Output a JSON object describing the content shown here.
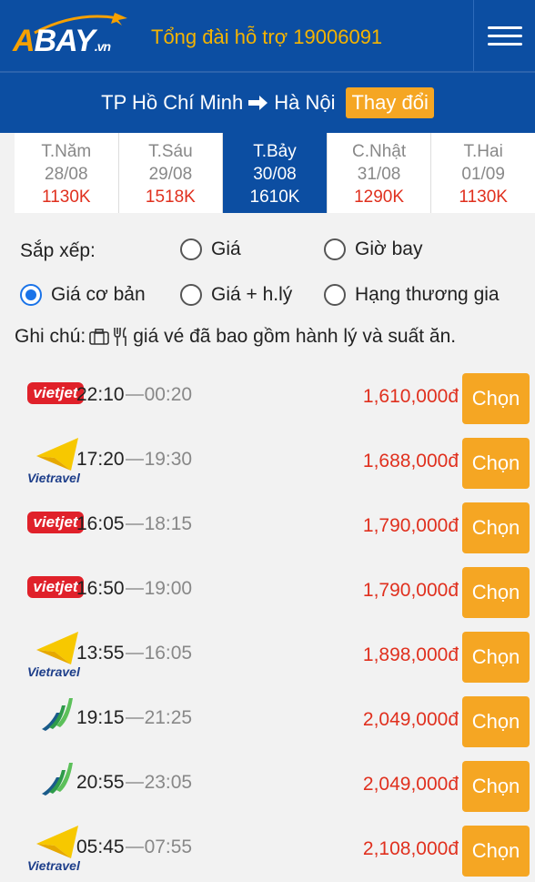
{
  "header": {
    "logo_text": "BAY",
    "logo_suffix": ".vn",
    "logo_a": "A",
    "hotline": "Tổng đài hỗ trợ 19006091"
  },
  "route": {
    "from": "TP Hồ Chí Minh",
    "to": "Hà Nội",
    "change_label": "Thay đổi"
  },
  "dates": [
    {
      "day": "T.Năm",
      "date": "28/08",
      "price": "1130K",
      "active": false
    },
    {
      "day": "T.Sáu",
      "date": "29/08",
      "price": "1518K",
      "active": false
    },
    {
      "day": "T.Bảy",
      "date": "30/08",
      "price": "1610K",
      "active": true
    },
    {
      "day": "C.Nhật",
      "date": "31/08",
      "price": "1290K",
      "active": false
    },
    {
      "day": "T.Hai",
      "date": "01/09",
      "price": "1130K",
      "active": false
    }
  ],
  "sort": {
    "label": "Sắp xếp:",
    "options": [
      {
        "label": "Giá",
        "checked": false
      },
      {
        "label": "Giờ bay",
        "checked": false
      },
      {
        "label": "Giá cơ bản",
        "checked": true
      },
      {
        "label": "Giá + h.lý",
        "checked": false
      },
      {
        "label": "Hạng thương gia",
        "checked": false
      }
    ]
  },
  "note": {
    "label": "Ghi chú:",
    "text": "giá vé đã bao gồm hành lý và suất ăn."
  },
  "flights": [
    {
      "airline": "vietjet",
      "logo_text": "vietjet",
      "depart": "22:10",
      "arrive": "00:20",
      "price": "1,610,000đ",
      "button": "Chọn"
    },
    {
      "airline": "vietravel",
      "logo_text": "Vietravel",
      "depart": "17:20",
      "arrive": "19:30",
      "price": "1,688,000đ",
      "button": "Chọn"
    },
    {
      "airline": "vietjet",
      "logo_text": "vietjet",
      "depart": "16:05",
      "arrive": "18:15",
      "price": "1,790,000đ",
      "button": "Chọn"
    },
    {
      "airline": "vietjet",
      "logo_text": "vietjet",
      "depart": "16:50",
      "arrive": "19:00",
      "price": "1,790,000đ",
      "button": "Chọn"
    },
    {
      "airline": "vietravel",
      "logo_text": "Vietravel",
      "depart": "13:55",
      "arrive": "16:05",
      "price": "1,898,000đ",
      "button": "Chọn"
    },
    {
      "airline": "bamboo",
      "logo_text": "",
      "depart": "19:15",
      "arrive": "21:25",
      "price": "2,049,000đ",
      "button": "Chọn"
    },
    {
      "airline": "bamboo",
      "logo_text": "",
      "depart": "20:55",
      "arrive": "23:05",
      "price": "2,049,000đ",
      "button": "Chọn"
    },
    {
      "airline": "vietravel",
      "logo_text": "Vietravel",
      "depart": "05:45",
      "arrive": "07:55",
      "price": "2,108,000đ",
      "button": "Chọn"
    }
  ],
  "colors": {
    "primary": "#0c4ea2",
    "accent": "#f5a623",
    "price": "#e0301e"
  }
}
